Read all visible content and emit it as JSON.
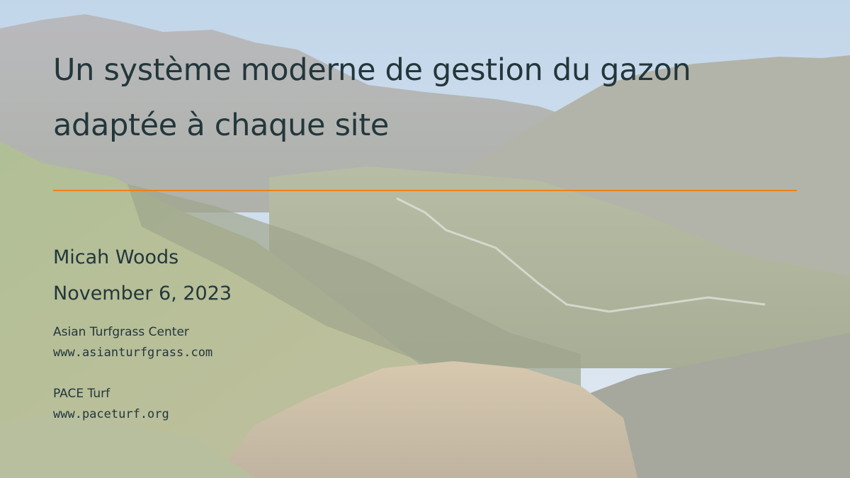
{
  "slide": {
    "title_line1": "Un système moderne de gestion du gazon",
    "title_line2": "adaptée à chaque site",
    "author": "Micah Woods",
    "date": "November 6, 2023",
    "affiliations": [
      {
        "name": "Asian Turfgrass Center",
        "url": "www.asianturfgrass.com"
      },
      {
        "name": "PACE Turf",
        "url": "www.paceturf.org"
      }
    ]
  },
  "colors": {
    "text": "#23373b",
    "accent_rule": "#eb811b"
  }
}
